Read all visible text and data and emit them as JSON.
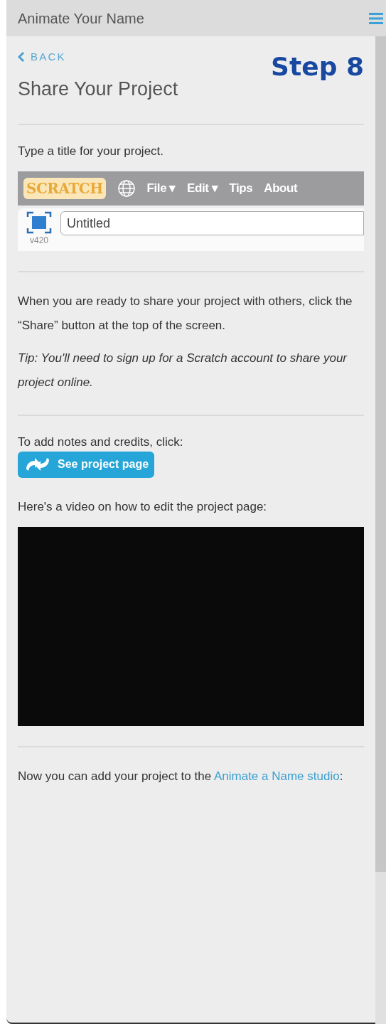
{
  "header": {
    "title": "Animate Your Name"
  },
  "back": {
    "label": "BACK"
  },
  "step_label": "Step 8",
  "heading": "Share Your Project",
  "sections": [
    {
      "kind": "editor",
      "text": "Type a title for your project.",
      "logo": "SCRATCH",
      "menu": [
        "File ▾",
        "Edit ▾",
        "Tips",
        "About"
      ],
      "version": "v420",
      "title_value": "Untitled"
    },
    {
      "kind": "share",
      "text": "When you are ready to share your project with others, click the “Share” button at the top of the screen.",
      "tip": "Tip: You'll need to sign up for a Scratch account to share your project online."
    },
    {
      "kind": "notes",
      "text": "To add notes and credits, click:",
      "button": "See project page",
      "video_caption": "Here's a video on how to edit the project page:"
    },
    {
      "kind": "studio",
      "text": "Now you can add your project to the ",
      "link": "Animate a Name studio",
      "after": ":"
    }
  ]
}
